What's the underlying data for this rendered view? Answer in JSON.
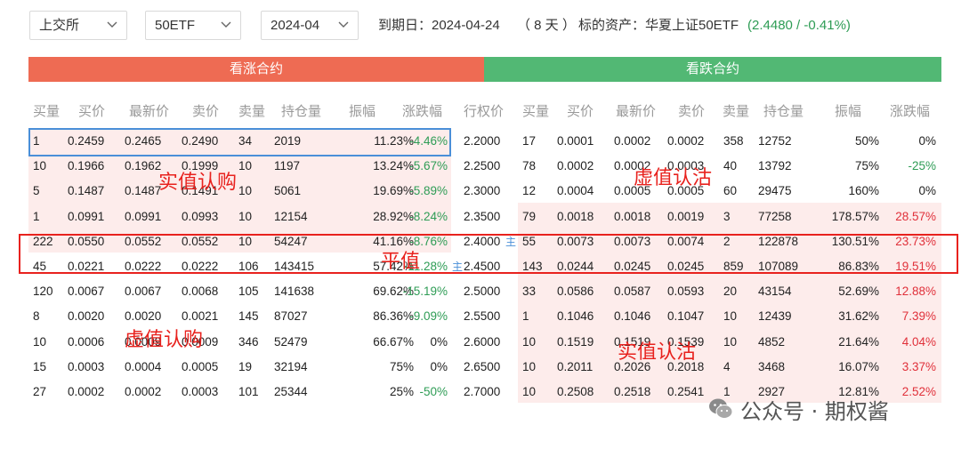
{
  "filters": {
    "exchange": "上交所",
    "underlying": "50ETF",
    "month": "2024-04"
  },
  "info": {
    "expiry": "到期日：2024-04-24",
    "days": "（ 8 天 ）",
    "asset": "标的资产：华夏上证50ETF",
    "price": "(2.4480 / -0.41%)"
  },
  "banners": {
    "call": "看涨合约",
    "put": "看跌合约"
  },
  "headers": {
    "call": [
      "买量",
      "买价",
      "最新价",
      "卖价",
      "卖量",
      "持仓量",
      "振幅",
      "涨跌幅"
    ],
    "strike": "行权价",
    "put": [
      "买量",
      "买价",
      "最新价",
      "卖价",
      "卖量",
      "持仓量",
      "振幅",
      "涨跌幅"
    ]
  },
  "rows": [
    {
      "call": [
        "1",
        "0.2459",
        "0.2465",
        "0.2490",
        "34",
        "2019",
        "11.23%",
        "-4.46%"
      ],
      "call_dir": "neg",
      "strike": "2.2000",
      "put": [
        "17",
        "0.0001",
        "0.0002",
        "0.0002",
        "358",
        "12752",
        "50%",
        "0%"
      ],
      "put_dir": "zero"
    },
    {
      "call": [
        "10",
        "0.1966",
        "0.1962",
        "0.1999",
        "10",
        "1197",
        "13.24%",
        "-5.67%"
      ],
      "call_dir": "neg",
      "strike": "2.2500",
      "put": [
        "78",
        "0.0002",
        "0.0002",
        "0.0003",
        "40",
        "13792",
        "75%",
        "-25%"
      ],
      "put_dir": "neg"
    },
    {
      "call": [
        "5",
        "0.1487",
        "0.1487",
        "0.1491",
        "10",
        "5061",
        "19.69%",
        "-5.89%"
      ],
      "call_dir": "neg",
      "strike": "2.3000",
      "put": [
        "12",
        "0.0004",
        "0.0005",
        "0.0005",
        "60",
        "29475",
        "160%",
        "0%"
      ],
      "put_dir": "zero"
    },
    {
      "call": [
        "1",
        "0.0991",
        "0.0991",
        "0.0993",
        "10",
        "12154",
        "28.92%",
        "-8.24%"
      ],
      "call_dir": "neg",
      "strike": "2.3500",
      "put": [
        "79",
        "0.0018",
        "0.0018",
        "0.0019",
        "3",
        "77258",
        "178.57%",
        "28.57%"
      ],
      "put_dir": "pos"
    },
    {
      "call": [
        "222",
        "0.0550",
        "0.0552",
        "0.0552",
        "10",
        "54247",
        "41.16%",
        "-8.76%"
      ],
      "call_dir": "neg",
      "strike": "2.4000",
      "strike_mark": "主",
      "put": [
        "55",
        "0.0073",
        "0.0073",
        "0.0074",
        "2",
        "122878",
        "130.51%",
        "23.73%"
      ],
      "put_dir": "pos"
    },
    {
      "call": [
        "45",
        "0.0221",
        "0.0222",
        "0.0222",
        "106",
        "143415",
        "57.42%",
        "-11.28%"
      ],
      "call_dir": "neg",
      "strike": "2.4500",
      "strike_mark": "主",
      "put": [
        "143",
        "0.0244",
        "0.0245",
        "0.0245",
        "859",
        "107089",
        "86.83%",
        "19.51%"
      ],
      "put_dir": "pos"
    },
    {
      "call": [
        "120",
        "0.0067",
        "0.0067",
        "0.0068",
        "105",
        "141638",
        "69.62%",
        "-15.19%"
      ],
      "call_dir": "neg",
      "strike": "2.5000",
      "put": [
        "33",
        "0.0586",
        "0.0587",
        "0.0593",
        "20",
        "43154",
        "52.69%",
        "12.88%"
      ],
      "put_dir": "pos"
    },
    {
      "call": [
        "8",
        "0.0020",
        "0.0020",
        "0.0021",
        "145",
        "87027",
        "86.36%",
        "-9.09%"
      ],
      "call_dir": "neg",
      "strike": "2.5500",
      "put": [
        "1",
        "0.1046",
        "0.1046",
        "0.1047",
        "10",
        "12439",
        "31.62%",
        "7.39%"
      ],
      "put_dir": "pos"
    },
    {
      "call": [
        "10",
        "0.0006",
        "0.0009",
        "0.0009",
        "346",
        "52479",
        "66.67%",
        "0%"
      ],
      "call_dir": "zero",
      "strike": "2.6000",
      "put": [
        "10",
        "0.1519",
        "0.1519",
        "0.1539",
        "10",
        "4852",
        "21.64%",
        "4.04%"
      ],
      "put_dir": "pos"
    },
    {
      "call": [
        "15",
        "0.0003",
        "0.0004",
        "0.0005",
        "19",
        "32194",
        "75%",
        "0%"
      ],
      "call_dir": "zero",
      "strike": "2.6500",
      "put": [
        "10",
        "0.2011",
        "0.2026",
        "0.2018",
        "4",
        "3468",
        "16.07%",
        "3.37%"
      ],
      "put_dir": "pos"
    },
    {
      "call": [
        "27",
        "0.0002",
        "0.0002",
        "0.0003",
        "101",
        "25344",
        "25%",
        "-50%"
      ],
      "call_dir": "neg",
      "strike": "2.7000",
      "put": [
        "10",
        "0.2508",
        "0.2518",
        "0.2541",
        "1",
        "2927",
        "12.81%",
        "2.52%"
      ],
      "put_dir": "pos"
    }
  ],
  "annotations": {
    "call_itm": "实值认购",
    "put_otm": "虚值认沽",
    "atm": "平值",
    "call_otm": "虚值认购",
    "put_itm": "实值认沽"
  },
  "watermark": "公众号 · 期权酱",
  "colors": {
    "call_banner": "#ee6b53",
    "put_banner": "#52b874",
    "up": "#e0303a",
    "down": "#2e9c55",
    "shade": "#fdeceb",
    "atm_box": "#e8221e",
    "selected_box": "#4a8fd8"
  }
}
